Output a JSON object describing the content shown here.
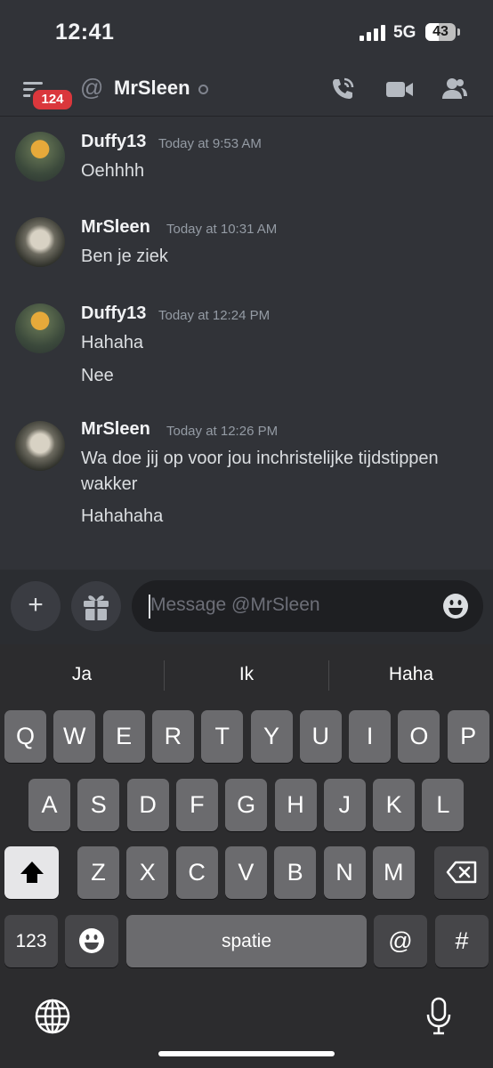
{
  "status_bar": {
    "time": "12:41",
    "network": "5G",
    "battery": "43",
    "battery_level": 0.43
  },
  "header": {
    "badge_count": "124",
    "at_symbol": "@",
    "title": "MrSleen"
  },
  "messages": [
    {
      "author": "Duffy13",
      "time": "Today at 9:53 AM",
      "lines": [
        "Oehhhh"
      ]
    },
    {
      "author": "MrSleen",
      "time": "Today at 10:31 AM",
      "lines": [
        "Ben je ziek"
      ]
    },
    {
      "author": "Duffy13",
      "time": "Today at 12:24 PM",
      "lines": [
        "Hahaha",
        "Nee"
      ]
    },
    {
      "author": "MrSleen",
      "time": "Today at 12:26 PM",
      "lines": [
        "Wa doe jij op voor jou inchristelijke tijdstippen wakker",
        "Hahahaha"
      ]
    }
  ],
  "composer": {
    "plus_label": "+",
    "placeholder": "Message @MrSleen"
  },
  "keyboard": {
    "suggestions": [
      "Ja",
      "Ik",
      "Haha"
    ],
    "row1": [
      "Q",
      "W",
      "E",
      "R",
      "T",
      "Y",
      "U",
      "I",
      "O",
      "P"
    ],
    "row2": [
      "A",
      "S",
      "D",
      "F",
      "G",
      "H",
      "J",
      "K",
      "L"
    ],
    "row3": [
      "Z",
      "X",
      "C",
      "V",
      "B",
      "N",
      "M"
    ],
    "numbers_label": "123",
    "space_label": "spatie",
    "at_label": "@",
    "hash_label": "#"
  },
  "icons": [
    "server-list-icon",
    "phone-call-icon",
    "video-camera-icon",
    "members-icon",
    "gift-icon",
    "emoji-icon",
    "shift-icon",
    "backspace-icon",
    "globe-icon",
    "microphone-icon"
  ],
  "colors": {
    "background": "#313338",
    "badge": "#da373c",
    "keyboard_bg": "#2c2c2e",
    "key": "#6b6b6e"
  }
}
